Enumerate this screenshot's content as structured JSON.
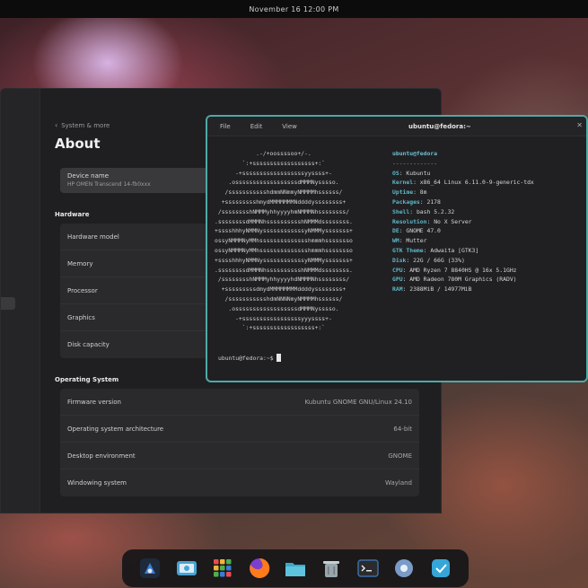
{
  "topbar": {
    "clock": "November 16 12:00 PM"
  },
  "settings": {
    "back_label": "System & more",
    "title": "About",
    "device": {
      "name": "Device name",
      "subtitle": "HP OMEN Transcend 14-fb0xxx"
    },
    "hardware_title": "Hardware",
    "hardware_rows": [
      {
        "label": "Hardware model",
        "value": ""
      },
      {
        "label": "Memory",
        "value": ""
      },
      {
        "label": "Processor",
        "value": ""
      },
      {
        "label": "Graphics",
        "value": ""
      },
      {
        "label": "Disk capacity",
        "value": ""
      }
    ],
    "os_title": "Operating System",
    "os_rows": [
      {
        "label": "Firmware version",
        "value": "Kubuntu GNOME GNU/Linux 24.10"
      },
      {
        "label": "Operating system architecture",
        "value": "64-bit"
      },
      {
        "label": "Desktop environment",
        "value": "GNOME"
      },
      {
        "label": "Windowing system",
        "value": "Wayland"
      }
    ]
  },
  "terminal": {
    "menu": [
      "File",
      "Edit",
      "View"
    ],
    "title": "ubuntu@fedora:~",
    "close": "✕",
    "ascii_lines": [
      "            .-/+oossssoo+/-.",
      "        `:+ssssssssssssssssss+:`",
      "      -+ssssssssssssssssssyyssss+-",
      "    .ossssssssssssssssssdMMMNysssso.",
      "   /ssssssssssshdmmNNmmyNMMMMhssssss/",
      "  +ssssssssshmydMMMMMMMNddddyssssssss+",
      " /sssssssshNMMMyhhyyyyhmNMMMNhssssssss/",
      ".ssssssssdMMMNhsssssssssshNMMMdssssssss.",
      "+sssshhhyNMMNyssssssssssssyNMMMysssssss+",
      "ossyNMMMNyMMhsssssssssssssshmmmhssssssso",
      "ossyNMMMNyMMhsssssssssssssshmmmhssssssso",
      "+sssshhhyNMMNyssssssssssssyNMMMysssssss+",
      ".ssssssssdMMMNhsssssssssshNMMMdssssssss.",
      " /sssssssshNMMMyhhyyyyhdNMMMNhssssssss/",
      "  +sssssssssdmydMMMMMMMMddddyssssssss+",
      "   /ssssssssssshdmNNNNmyNMMMMhssssss/",
      "    .ossssssssssssssssssdMMMNysssso.",
      "      -+sssssssssssssssssyyyssss+-",
      "        `:+ssssssssssssssssss+:`"
    ],
    "info": {
      "host": "ubuntu@fedora",
      "separator": "-------------",
      "rows": [
        {
          "key": "OS",
          "value": "Kubuntu"
        },
        {
          "key": "Kernel",
          "value": "x86_64 Linux 6.11.0-9-generic-tdx"
        },
        {
          "key": "Uptime",
          "value": "8m"
        },
        {
          "key": "Packages",
          "value": "2178"
        },
        {
          "key": "Shell",
          "value": "bash 5.2.32"
        },
        {
          "key": "Resolution",
          "value": "No X Server"
        },
        {
          "key": "DE",
          "value": "GNOME 47.0"
        },
        {
          "key": "WM",
          "value": "Mutter"
        },
        {
          "key": "GTK Theme",
          "value": "Adwaita [GTK3]"
        },
        {
          "key": "Disk",
          "value": "22G / 66G (33%)"
        },
        {
          "key": "CPU",
          "value": "AMD Ryzen 7 8840HS @ 16x 5.1GHz"
        },
        {
          "key": "GPU",
          "value": "AMD Radeon 780M Graphics (RADV)"
        },
        {
          "key": "RAM",
          "value": "2388MiB / 14977MiB"
        }
      ]
    },
    "prompt": "ubuntu@fedora:~$"
  },
  "dock": {
    "items": [
      {
        "name": "app-center-icon",
        "color": "#3b7bd9"
      },
      {
        "name": "screenshot-icon",
        "color": "#4aa3d6"
      },
      {
        "name": "app-grid-icon",
        "color": "#e84d4d"
      },
      {
        "name": "firefox-icon",
        "color": "#ff7a1a"
      },
      {
        "name": "files-icon",
        "color": "#3aa9c9"
      },
      {
        "name": "trash-icon",
        "color": "#9aa6ad"
      },
      {
        "name": "terminal-icon",
        "color": "#3b6ea8"
      },
      {
        "name": "settings-icon",
        "color": "#7a9bc8"
      },
      {
        "name": "software-icon",
        "color": "#35a6d8"
      }
    ]
  }
}
